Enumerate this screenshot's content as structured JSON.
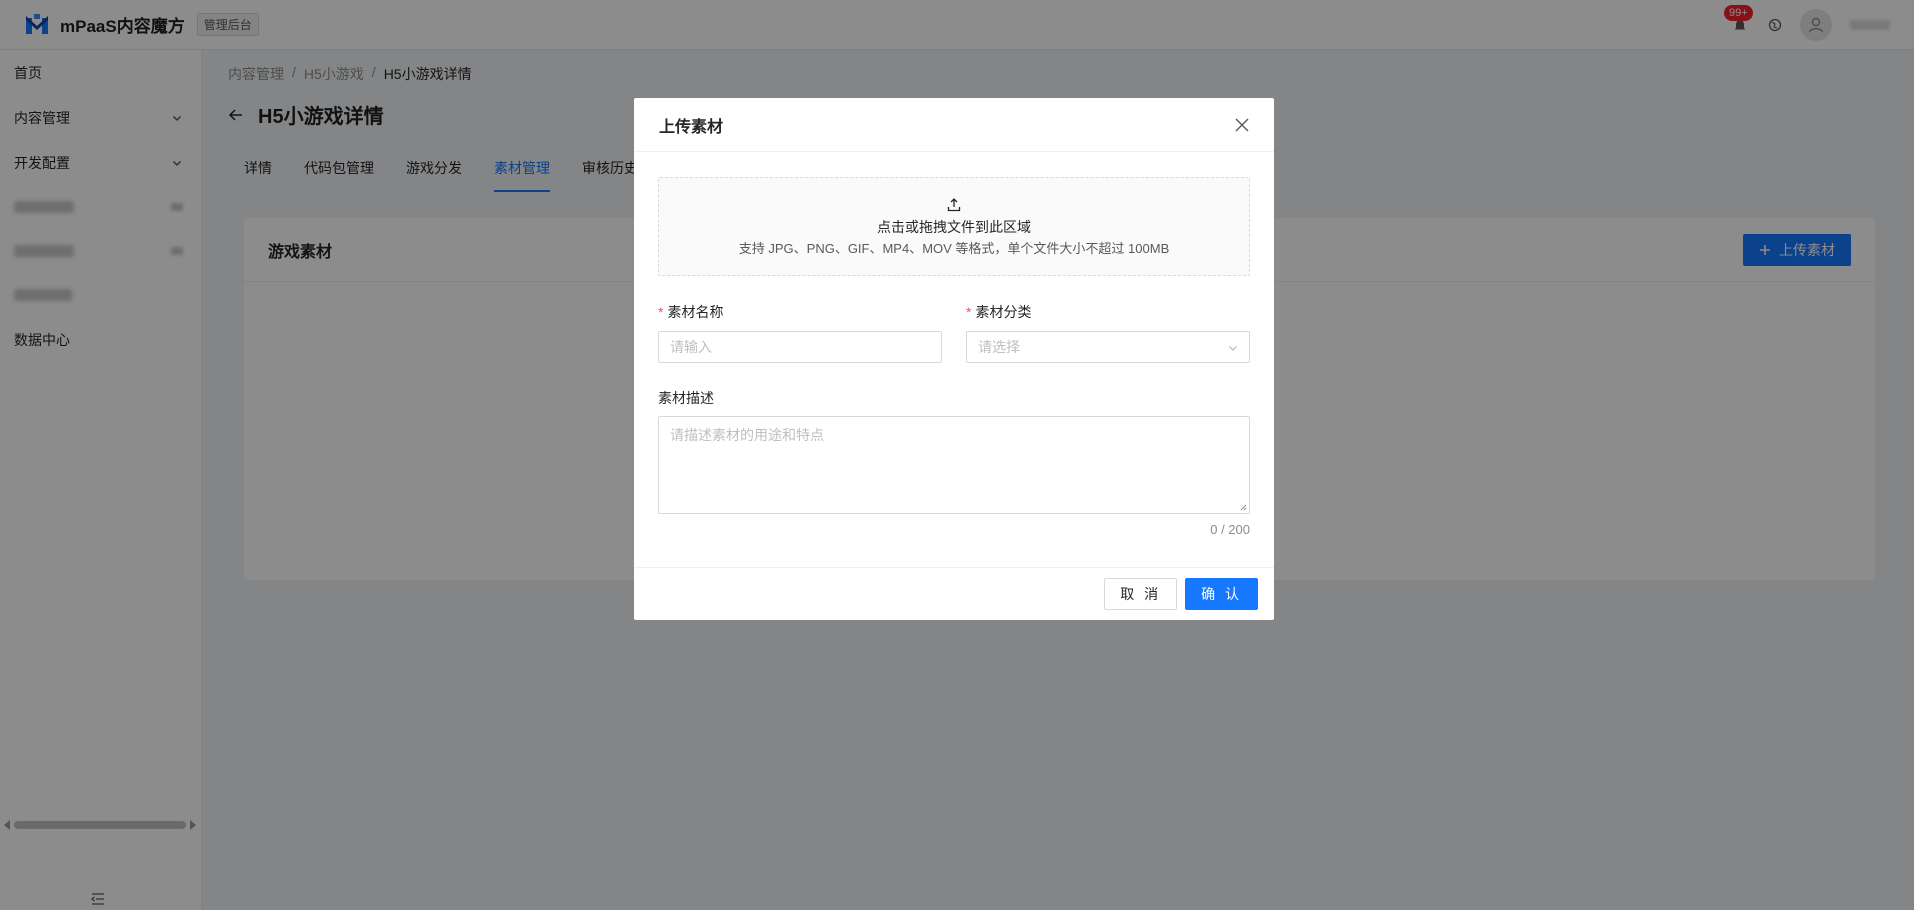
{
  "header": {
    "app_name": "mPaaS内容魔方",
    "admin_tag": "管理后台",
    "badge": "99+"
  },
  "sidebar": {
    "items": [
      {
        "label": "首页"
      },
      {
        "label": "内容管理"
      },
      {
        "label": "开发配置"
      },
      {
        "label": "数据中心"
      }
    ]
  },
  "breadcrumb": [
    "内容管理",
    "/",
    "H5小游戏",
    "/",
    "H5小游戏详情"
  ],
  "page": {
    "title": "H5小游戏详情",
    "tabs": [
      "详情",
      "代码包管理",
      "游戏分发",
      "素材管理",
      "审核历史"
    ],
    "active_tab": 3
  },
  "card": {
    "title": "游戏素材",
    "upload_button": "上传素材"
  },
  "modal": {
    "title": "上传素材",
    "dropzone_text": "点击或拖拽文件到此区域",
    "dropzone_hint": "支持 JPG、PNG、GIF、MP4、MOV 等格式，单个文件大小不超过 100MB",
    "name_label": "素材名称",
    "name_placeholder": "请输入",
    "category_label": "素材分类",
    "category_placeholder": "请选择",
    "desc_label": "素材描述",
    "desc_placeholder": "请描述素材的用途和特点",
    "counter": "0 / 200",
    "cancel": "取 消",
    "confirm": "确 认"
  },
  "colors": {
    "primary": "#1677ff",
    "required": "#ff4d4f",
    "badge": "#f5222d"
  },
  "icons": [
    "logo-icon",
    "bell-icon",
    "globe-icon",
    "user-icon",
    "chevron-down-icon",
    "arrow-left-icon",
    "plus-icon",
    "close-icon",
    "upload-icon",
    "collapse-icon"
  ]
}
